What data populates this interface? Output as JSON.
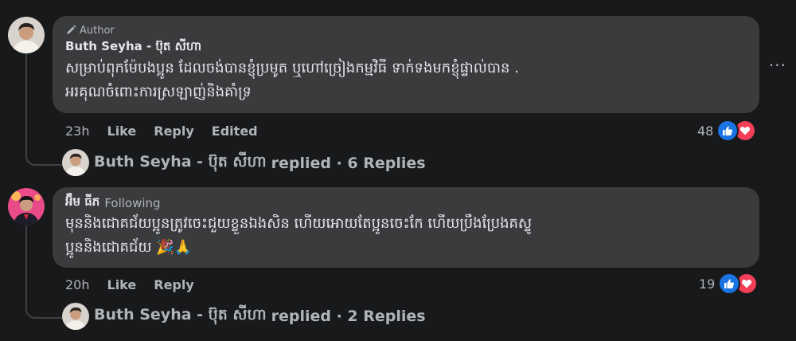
{
  "comments": [
    {
      "badge": "Author",
      "author": "Buth Seyha - ប៊ុត សីហា",
      "following": "",
      "line1": "សម្រាប់ពុកម៉ែបងប្អូន ដែលចង់បានខ្ញុំប្រមូត ឬហៅច្រៀងកម្មវិធី ទាក់ទងមកខ្ញុំផ្ទាល់បាន .",
      "line2": "អរគុណចំពោះការស្រឡាញ់និងគាំទ្រ",
      "time": "23h",
      "like": "Like",
      "reply": "Reply",
      "edited": "Edited",
      "reaction_count": "48",
      "replies_author": "Buth Seyha - ប៊ុត សីហា",
      "replies_text": "replied · 6 Replies"
    },
    {
      "badge": "",
      "author": "អ៊ឹម ធីភ",
      "following": "Following",
      "line1": "មុននិងជោគជ័យប្អូនត្រូវចេះជួយខ្លួនឯងសិន ហើយអោយតែប្អូនចេះកែ ហើយប្រឹងប្រែងគស្ទូ",
      "line2": "ប្អូននិងជោគជ័យ 🎉🙏",
      "time": "20h",
      "like": "Like",
      "reply": "Reply",
      "edited": "",
      "reaction_count": "19",
      "replies_author": "Buth Seyha - ប៊ុត សីហា",
      "replies_text": "replied · 2 Replies"
    }
  ],
  "more_menu": "···",
  "colors": {
    "like": "#1b74e4",
    "love": "#f33e58",
    "bubble": "#3a3b3c",
    "bg": "#18191a"
  },
  "icons": {
    "badge": "pencil-icon",
    "like": "thumbs-up-icon",
    "love": "heart-icon",
    "more": "more-dots-icon"
  }
}
